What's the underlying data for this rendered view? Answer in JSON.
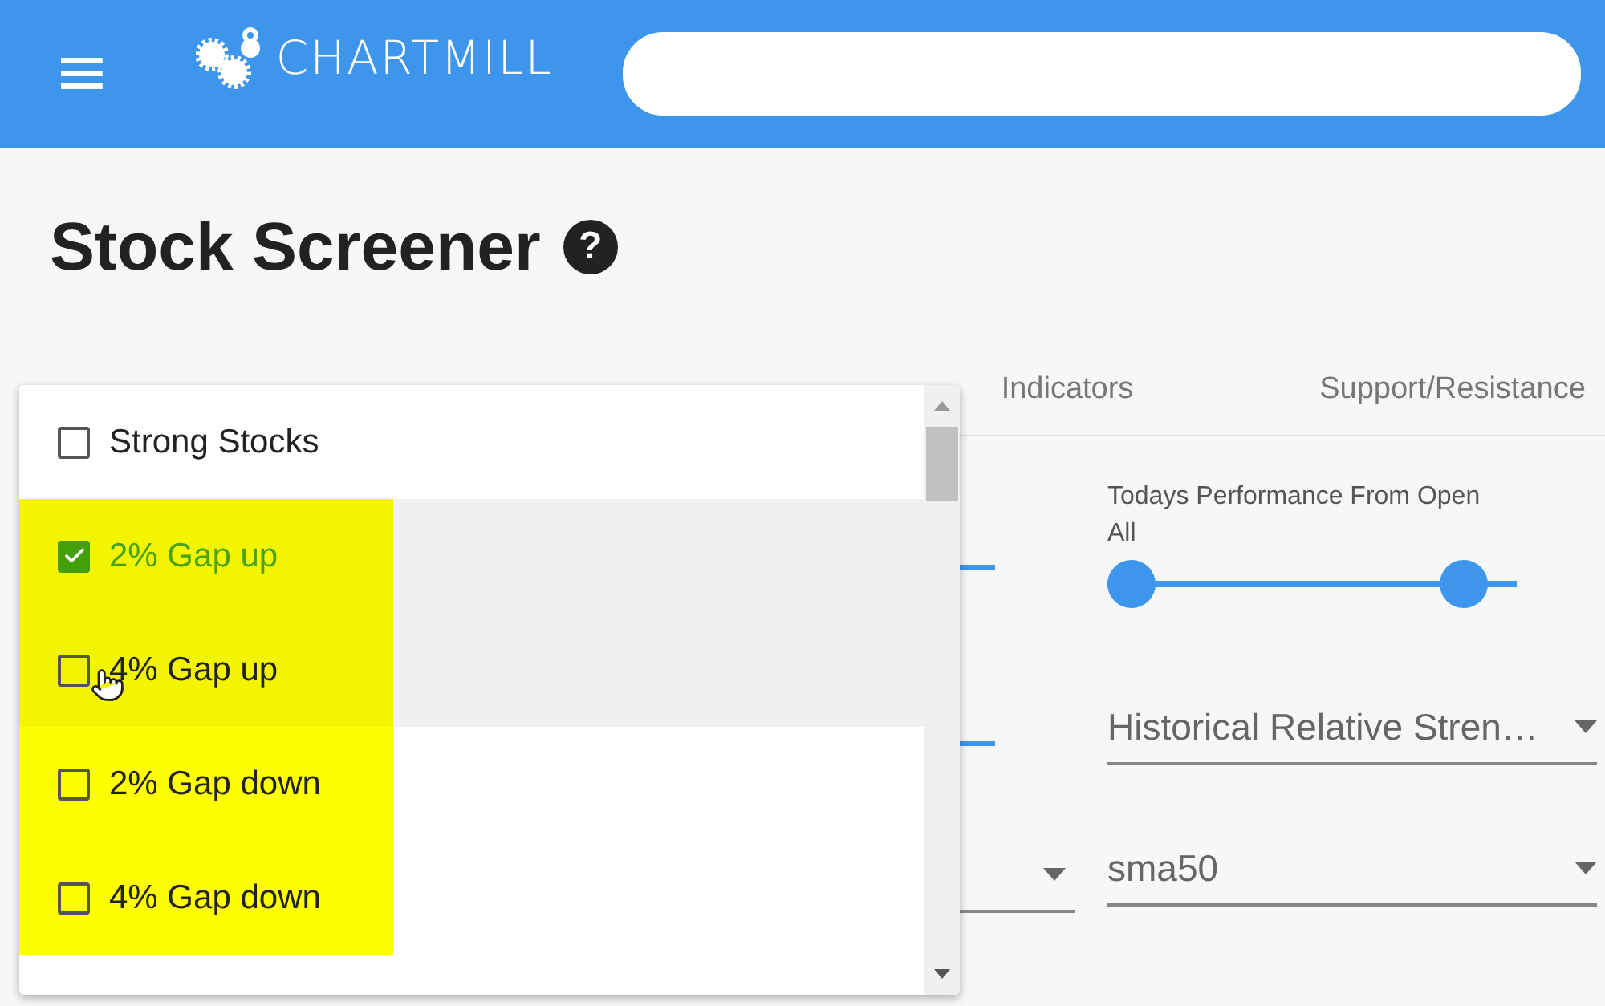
{
  "header": {
    "logo": "CHARTMILL"
  },
  "page": {
    "title": "Stock Screener",
    "help": "?"
  },
  "tabs": [
    {
      "label": "Indicators",
      "selected": false
    },
    {
      "label": "Support/Resistance",
      "selected": false
    }
  ],
  "filters": {
    "range_slider": {
      "label": "Todays Performance From Open",
      "value": "All",
      "level": 0.92
    },
    "selects": [
      {
        "value": "Historical Relative Stren…"
      },
      {
        "value": "sma50"
      }
    ]
  },
  "dropdown": {
    "items": [
      {
        "label": "Strong Stocks",
        "checked": false,
        "selected": false,
        "highlighted": false
      },
      {
        "label": "2% Gap up",
        "checked": true,
        "selected": true,
        "highlighted": true
      },
      {
        "label": "4% Gap up",
        "checked": false,
        "selected": true,
        "highlighted": true
      },
      {
        "label": "2% Gap down",
        "checked": false,
        "selected": false,
        "highlighted": true
      },
      {
        "label": "4% Gap down",
        "checked": false,
        "selected": false,
        "highlighted": true
      }
    ]
  }
}
